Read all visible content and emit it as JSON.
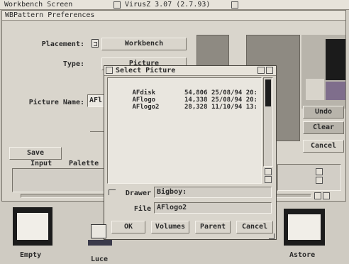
{
  "screen_bar": {
    "title": "Workbench Screen",
    "version": "VirusZ 3.07 (2.7.93)"
  },
  "prefs_window": {
    "title": "WBPattern Preferences",
    "placement_label": "Placement:",
    "placement_value": "Workbench",
    "type_label": "Type:",
    "type_value": "Picture",
    "picture_name_label": "Picture Name:",
    "picture_name_value": "AFl",
    "save_button": "Save",
    "undo_button": "Undo",
    "clear_button": "Clear",
    "cancel_button": "Cancel",
    "tabs": [
      "Input",
      "Palette"
    ]
  },
  "file_requester": {
    "title": "Select Picture",
    "files": [
      {
        "name": "AFdisk",
        "size": "54,806",
        "date": "25/08/94",
        "time": "20:"
      },
      {
        "name": "AFlogo",
        "size": "14,338",
        "date": "25/08/94",
        "time": "20:"
      },
      {
        "name": "AFlogo2",
        "size": "28,328",
        "date": "11/10/94",
        "time": "13:"
      }
    ],
    "drawer_label": "Drawer",
    "drawer_value": "Bigboy:",
    "file_label": "File",
    "file_value": "AFlogo2",
    "ok_button": "OK",
    "volumes_button": "Volumes",
    "parent_button": "Parent",
    "cancel_button": "Cancel"
  },
  "desktop_icons": [
    {
      "label": "Empty"
    },
    {
      "label": "Luce"
    },
    {
      "label": "Astore"
    }
  ],
  "colors": {
    "desktop": "#cfcbc2",
    "swatch_grey": "#8e8a82",
    "swatch_light": "#b8b4ab",
    "swatch_purple": "#7f6e8c",
    "swatch_black": "#1b1b1b"
  }
}
